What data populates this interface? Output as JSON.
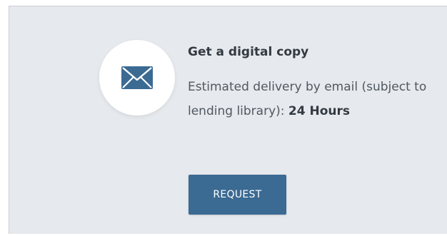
{
  "card": {
    "icon": "envelope-icon",
    "title": "Get a digital copy",
    "description_prefix": "Estimated delivery by email (subject to",
    "description_line2_prefix": "lending library):",
    "delivery_time": "24 Hours",
    "button_label": "REQUEST"
  },
  "colors": {
    "panel_background": "#e6e9ed",
    "button_background": "#3b6a93",
    "icon_color": "#3b6a93",
    "title_color": "#333a41",
    "text_color": "#505861"
  }
}
